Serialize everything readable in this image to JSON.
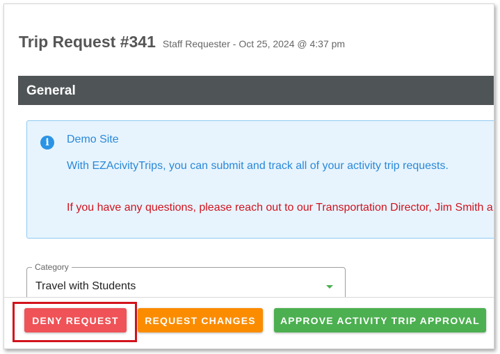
{
  "header": {
    "title": "Trip Request #341",
    "subtitle": "Staff Requester - Oct 25, 2024 @ 4:37 pm"
  },
  "section": {
    "title": "General"
  },
  "notice": {
    "icon": "info-icon",
    "icon_glyph": "i",
    "heading": "Demo Site",
    "text": "With EZAcivityTrips, you can submit and track all of your activity trip requests.",
    "warning": "If you have any questions, please reach out to our Transportation Director, Jim Smith a"
  },
  "category": {
    "label": "Category",
    "value": "Travel with Students"
  },
  "actions": {
    "deny_label": "DENY REQUEST",
    "changes_label": "REQUEST CHANGES",
    "approve_label": "APPROVE ACTIVITY TRIP APPROVAL"
  },
  "colors": {
    "section_bar": "#4f5456",
    "info_background": "#e7f4fd",
    "info_text": "#2a88d8",
    "warning_text": "#d0121e",
    "deny": "#ef5257",
    "changes": "#fb8c00",
    "approve": "#4caf50",
    "highlight": "#d2121b"
  }
}
